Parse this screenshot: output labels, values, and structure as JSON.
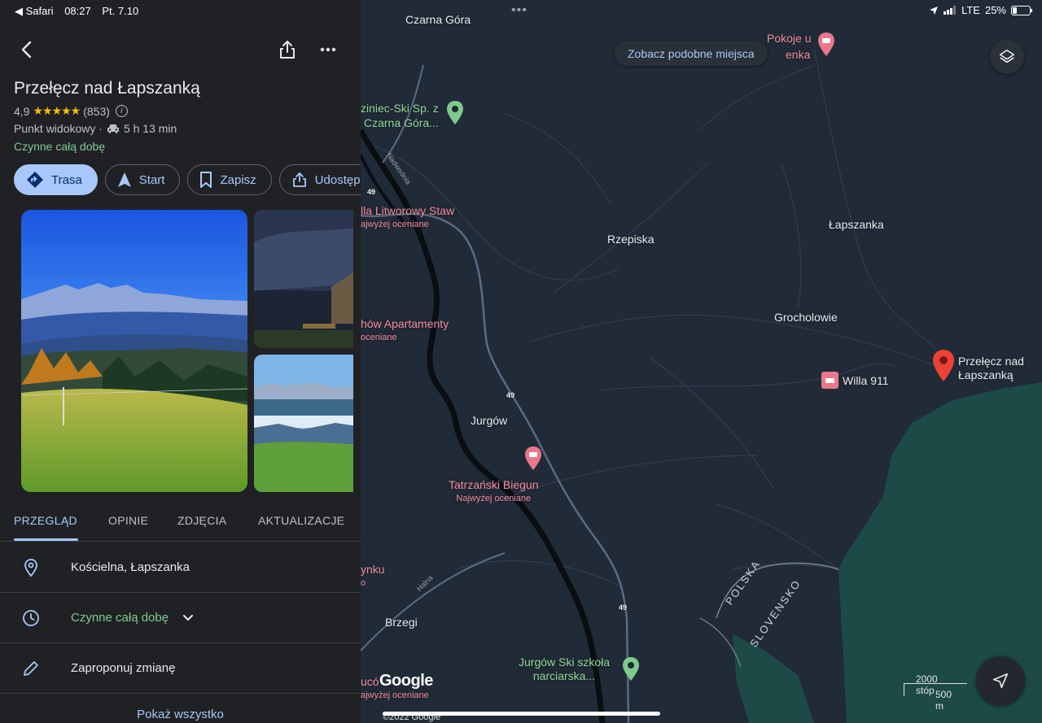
{
  "status_bar": {
    "back_app": "◀ Safari",
    "time": "08:27",
    "date": "Pt. 7.10",
    "network": "LTE",
    "battery": "25%"
  },
  "map": {
    "chip_label": "Zobacz podobne miejsca",
    "towns": [
      "Czarna Góra",
      "Rzepiska",
      "Łapszanka",
      "Grocholowie",
      "Jurgów",
      "Brzegi"
    ],
    "pois": {
      "pokoje": "Pokoje u",
      "pokoje_tail": "enka",
      "ski_1": "ziniec-Ski Sp. z",
      "ski_2": "Czarna Góra...",
      "willa_litworowy": "lla Litworowy Staw",
      "willa_litworowy_sub": "ajwyżej oceniane",
      "apartamenty": "hów Apartamenty",
      "apartamenty_sub": "oceniane",
      "tatrzanski": "Tatrzański Biegun",
      "tatrzanski_sub": "Najwyżej oceniane",
      "willa_911": "Willa 911",
      "pass_1": "Przełęcz nad",
      "pass_2": "Łapszanką",
      "nku": "ynku",
      "nku_sub": "o",
      "jurgow_ski_1": "Jurgów Ski szkoła",
      "jurgow_ski_2": "narciarska...",
      "uco": "ucó",
      "uco_sub": "ajwyżej oceniane"
    },
    "roads": {
      "r49": "49",
      "nadwodnia": "Nadwodnia",
      "halna": "Halna"
    },
    "border": {
      "pl": "POLSKA",
      "sk": "SLOVENSKO"
    },
    "scale_top": "2000 stóp",
    "scale_bottom": "500 m",
    "google": "Google",
    "copyright": "©2022 Google"
  },
  "place": {
    "title": "Przełęcz nad Łapszanką",
    "rating": "4,9",
    "stars": "★★★★★",
    "reviews": "(853)",
    "category": "Punkt widokowy ·",
    "drive_time": "5 h 13 min",
    "open_status": "Czynne całą dobę",
    "actions": {
      "route": "Trasa",
      "start": "Start",
      "save": "Zapisz",
      "share": "Udostępnij"
    },
    "tabs": [
      "PRZEGLĄD",
      "OPINIE",
      "ZDJĘCIA",
      "AKTUALIZACJE"
    ],
    "address": "Kościelna, Łapszanka",
    "hours": "Czynne całą dobę",
    "suggest_edit": "Zaproponuj zmianę",
    "show_all": "Pokaż wszystko"
  },
  "colors": {
    "accent": "#a8c7fa",
    "open_green": "#81c995",
    "star_yellow": "#fbbc04",
    "poi_red": "#f28b9b",
    "map_bg": "#212a37",
    "water_teal": "#1e4a4a"
  }
}
